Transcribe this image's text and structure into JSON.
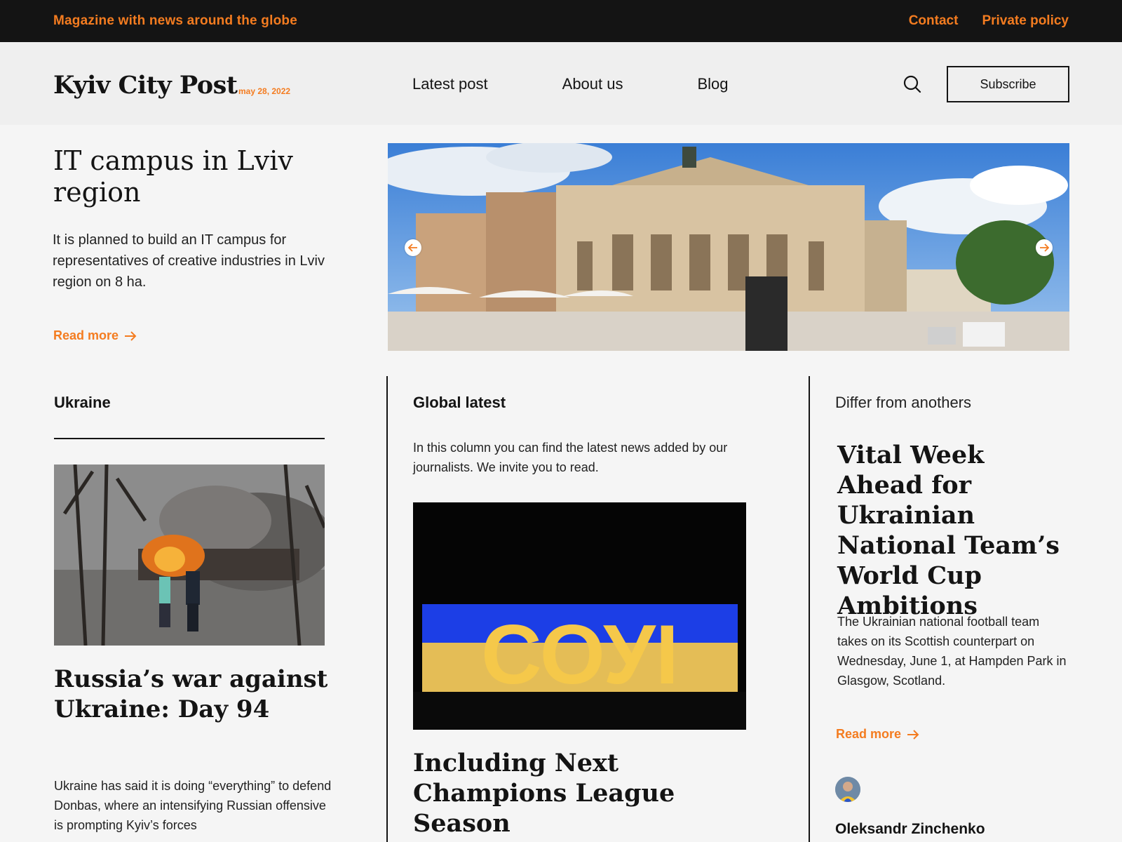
{
  "topbar": {
    "tagline": "Magazine with news around the globe",
    "links": [
      "Contact",
      "Private policy"
    ]
  },
  "header": {
    "logo": "Kyiv City Post",
    "date": "may 28, 2022",
    "nav": [
      "Latest post",
      "About us",
      "Blog"
    ],
    "search_icon": "search-icon",
    "subscribe_label": "Subscribe"
  },
  "hero": {
    "title": "IT campus in Lviv region",
    "text": "It is planned to build an IT campus for representatives of creative industries in Lviv region on 8 ha.",
    "read_more": "Read more",
    "image": "lviv-opera-house-photo"
  },
  "columns": {
    "ukraine": {
      "heading": "Ukraine",
      "image": "burning-building-photo",
      "title": "Russia’s war against Ukraine: Day 94",
      "text": "Ukraine has said it is doing “everything” to defend Donbas, where an intensifying Russian offensive is prompting Kyiv’s forces"
    },
    "global": {
      "heading": "Global latest",
      "text": "In this column you can find the latest news added by our journalists. We invite you to read.",
      "image": "stadium-banner-photo",
      "banner_text": "СОУІ",
      "title": "Including Next Champions League Season"
    },
    "differ": {
      "heading": "Differ from anothers",
      "title": "Vital Week Ahead for Ukrainian National Team’s World Cup Ambitions",
      "text": "The Ukrainian national football team takes on its Scottish counterpart on Wednesday, June 1, at Hampden Park in Glasgow, Scotland.",
      "read_more": "Read more",
      "author": "Oleksandr Zinchenko"
    }
  },
  "colors": {
    "accent": "#f47c20",
    "dark": "#141414",
    "background": "#f5f5f5"
  }
}
